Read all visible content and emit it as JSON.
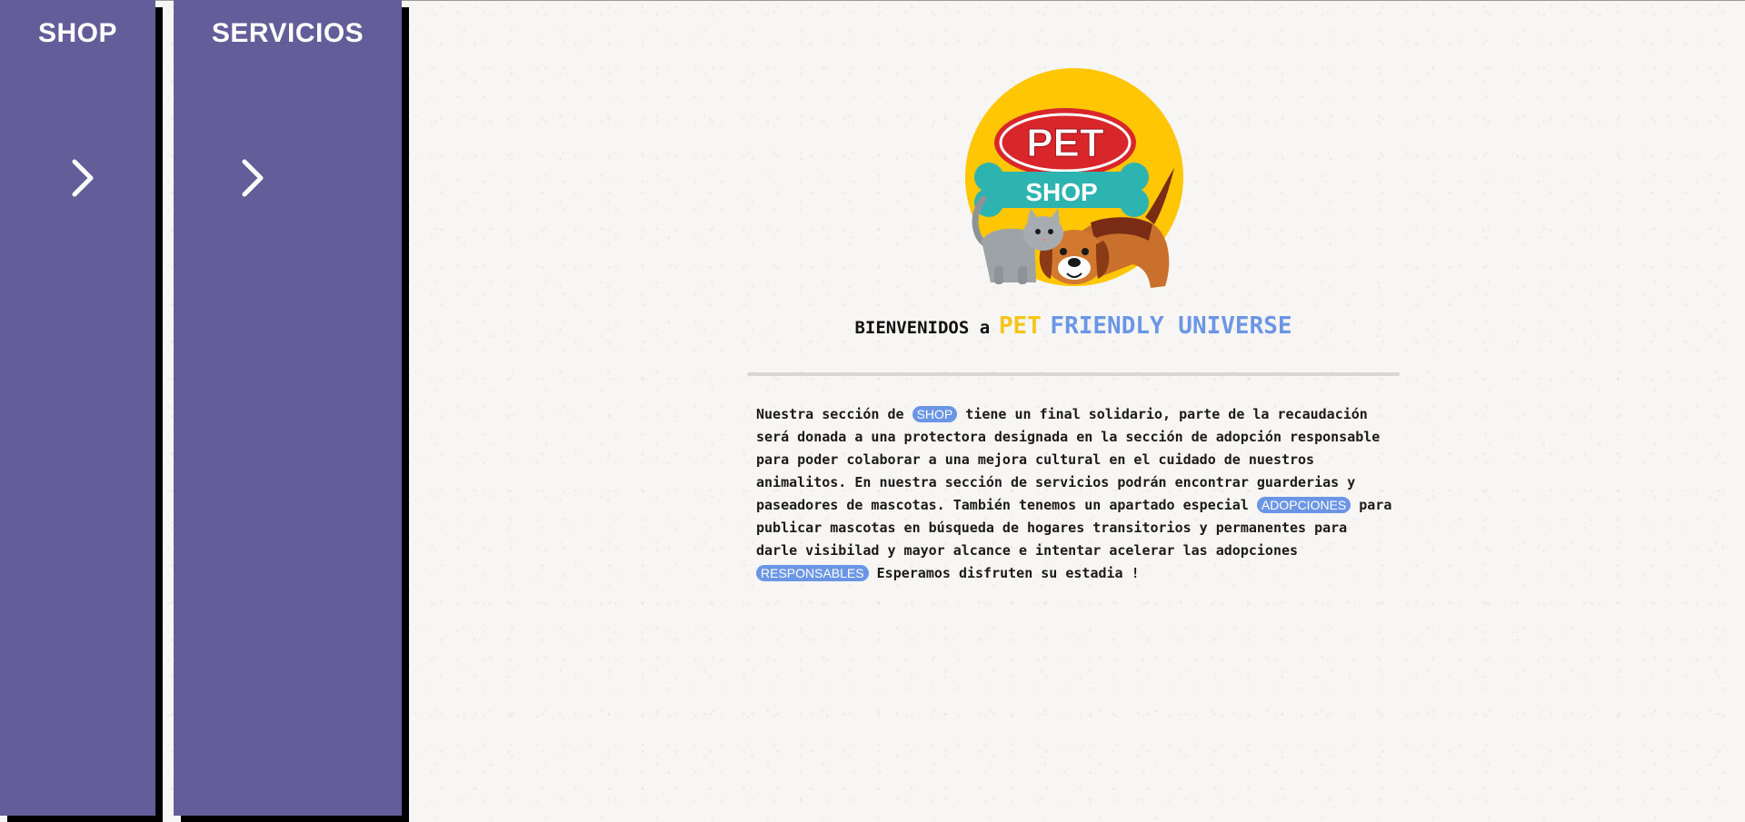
{
  "nav": {
    "shop": {
      "label": "SHOP"
    },
    "services": {
      "label": "SERVICIOS"
    }
  },
  "logo": {
    "text_top": "PET",
    "text_bottom": "SHOP"
  },
  "welcome": {
    "prefix": "BIENVENIDOS a",
    "word1": "PET",
    "word2": "FRIENDLY UNIVERSE"
  },
  "intro": {
    "t1": "Nuestra sección de ",
    "pill1": "SHOP",
    "t2": " tiene un final solidario, parte de la recaudación será donada a una protectora designada en la sección de adopción responsable para poder colaborar a una mejora cultural en el cuidado de nuestros animalitos. En nuestra sección de servicios podrán encontrar guarderias y paseadores de mascotas. También tenemos un apartado especial ",
    "pill2": "ADOPCIONES",
    "t3": " para publicar mascotas en búsqueda de hogares transitorios y permanentes para darle visibilad y mayor alcance e intentar acelerar las adopciones ",
    "pill3": "RESPONSABLES",
    "t4": " Esperamos disfruten su estadia !"
  },
  "colors": {
    "nav_bg": "#635d9a",
    "accent_yellow": "#f5c518",
    "accent_blue": "#6b96e6"
  },
  "icons": {
    "nav_arrow": "chevron-right-icon"
  }
}
